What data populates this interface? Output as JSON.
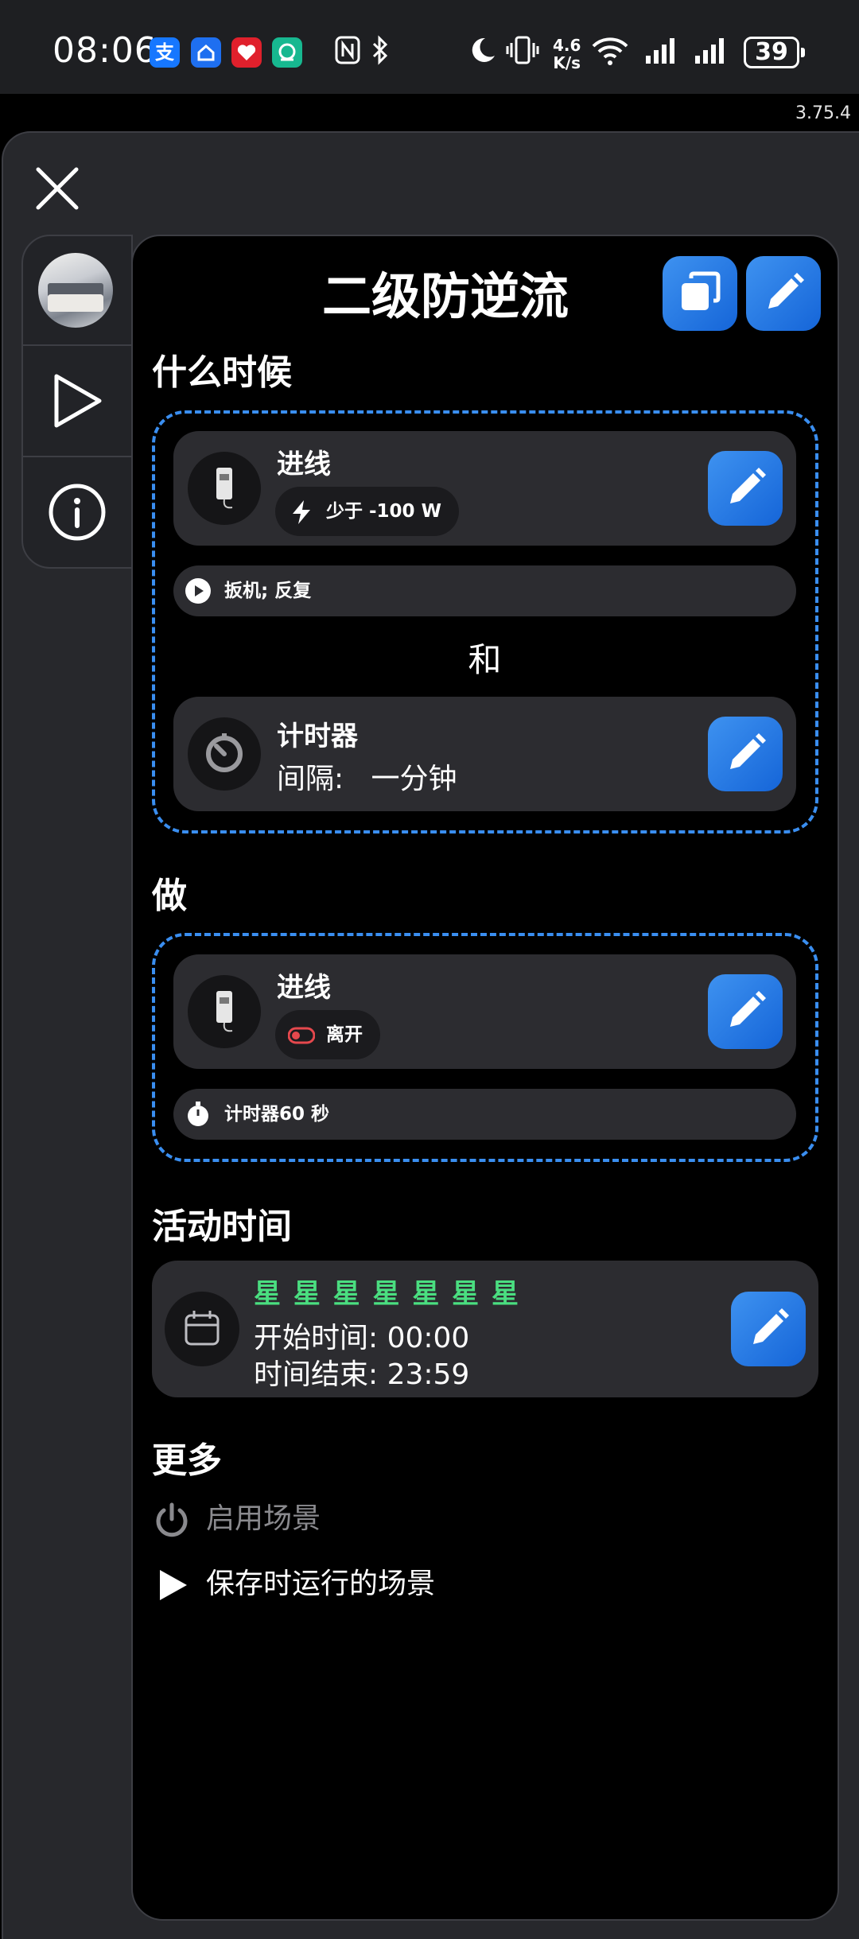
{
  "status_bar": {
    "time": "08:06",
    "net_speed_top": "4.6",
    "net_speed_bottom": "K/s",
    "battery": "39",
    "icons": [
      "alipay-icon",
      "home-app-icon",
      "health-app-icon",
      "green-app-icon",
      "nfc-icon",
      "bluetooth-icon",
      "moon-icon",
      "vibrate-icon",
      "wifi-icon",
      "signal-icon",
      "signal-icon",
      "battery-icon"
    ]
  },
  "version": "3.75.4",
  "scene": {
    "title": "二级防逆流"
  },
  "when": {
    "heading": "什么时候",
    "trigger_card": {
      "title": "进线",
      "chip": "少于 -100 W",
      "chip_icon": "lightning-icon"
    },
    "trigger_pill": "扳机; 反复",
    "conjunction": "和",
    "timer_card": {
      "title": "计时器",
      "detail": "间隔:   一分钟"
    }
  },
  "do": {
    "heading": "做",
    "action_card": {
      "title": "进线",
      "chip": "离开",
      "chip_icon": "toggle-off-icon"
    },
    "action_pill": "计时器60 秒"
  },
  "active_time": {
    "heading": "活动时间",
    "days": "星 星 星 星 星 星 星",
    "start": "开始时间: 00:00",
    "end": "时间结束: 23:59"
  },
  "more": {
    "heading": "更多",
    "enable_scene": "启用场景",
    "run_on_save": "保存时运行的场景"
  },
  "colors": {
    "accent": "#1e7be6",
    "dashed_border": "#3a8ef0",
    "days_green": "#4ade80",
    "toggle_red": "#e5484d"
  }
}
